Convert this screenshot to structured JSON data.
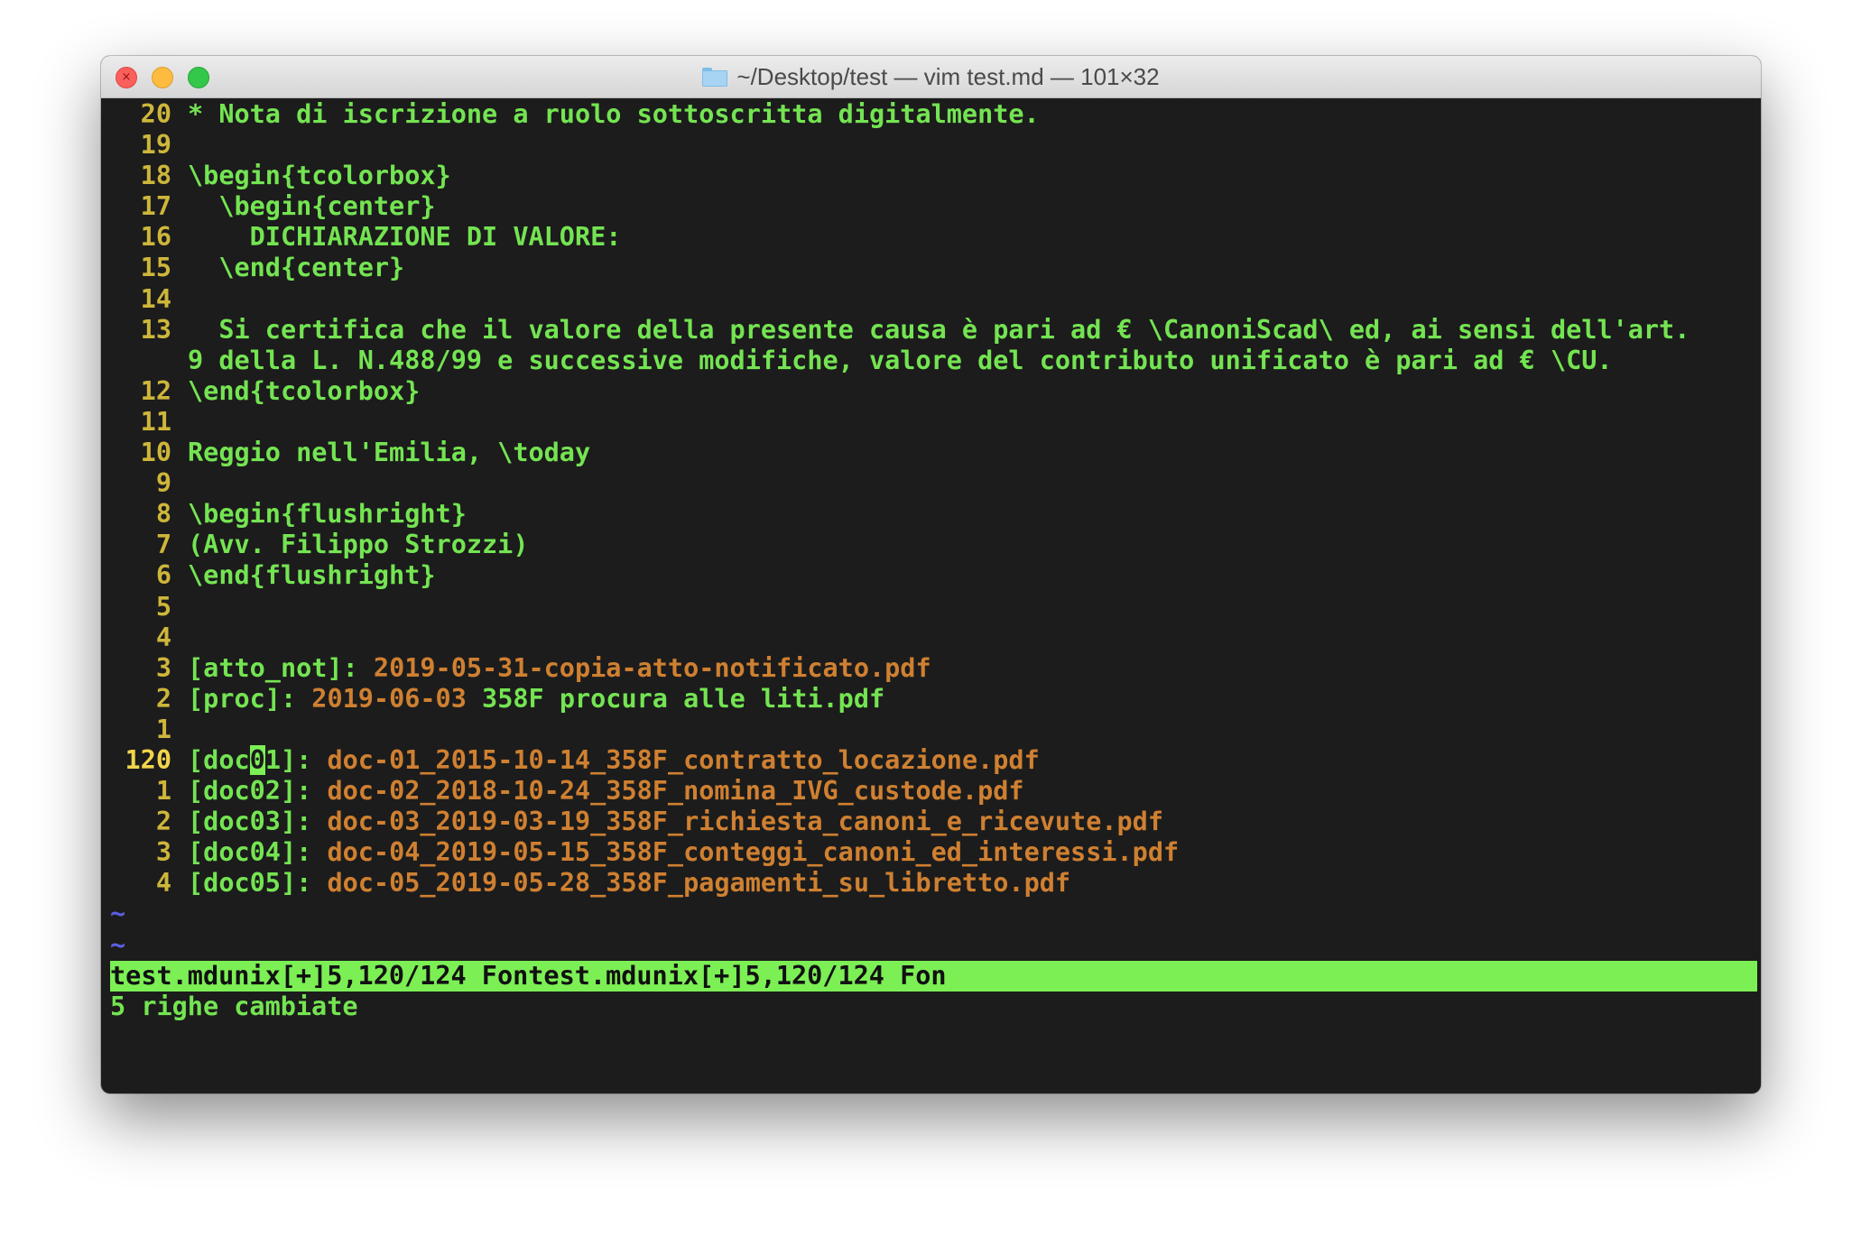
{
  "window": {
    "title": "~/Desktop/test — vim test.md — 101×32",
    "close_glyph": "×"
  },
  "buffer": {
    "lines": [
      {
        "num": "20",
        "parts": [
          {
            "t": "* Nota di iscrizione a ruolo sottoscritta digitalmente.",
            "c": "g"
          }
        ]
      },
      {
        "num": "19",
        "parts": []
      },
      {
        "num": "18",
        "parts": [
          {
            "t": "\\begin{tcolorbox}",
            "c": "g"
          }
        ]
      },
      {
        "num": "17",
        "parts": [
          {
            "t": "  \\begin{center}",
            "c": "g"
          }
        ]
      },
      {
        "num": "16",
        "parts": [
          {
            "t": "    DICHIARAZIONE DI VALORE:",
            "c": "g"
          }
        ]
      },
      {
        "num": "15",
        "parts": [
          {
            "t": "  \\end{center}",
            "c": "g"
          }
        ]
      },
      {
        "num": "14",
        "parts": []
      },
      {
        "num": "13",
        "parts": [
          {
            "t": "  Si certifica che il valore della presente causa è pari ad € \\CanoniScad\\ ed, ai sensi dell'art.",
            "c": "g"
          }
        ]
      },
      {
        "num": "",
        "parts": [
          {
            "t": "9 della L. N.488/99 e successive modifiche, valore del contributo unificato è pari ad € \\CU.",
            "c": "g"
          }
        ]
      },
      {
        "num": "12",
        "parts": [
          {
            "t": "\\end{tcolorbox}",
            "c": "g"
          }
        ]
      },
      {
        "num": "11",
        "parts": []
      },
      {
        "num": "10",
        "parts": [
          {
            "t": "Reggio nell'Emilia, \\today",
            "c": "g"
          }
        ]
      },
      {
        "num": "9",
        "parts": []
      },
      {
        "num": "8",
        "parts": [
          {
            "t": "\\begin{flushright}",
            "c": "g"
          }
        ]
      },
      {
        "num": "7",
        "parts": [
          {
            "t": "(Avv. Filippo Strozzi)",
            "c": "g"
          }
        ]
      },
      {
        "num": "6",
        "parts": [
          {
            "t": "\\end{flushright}",
            "c": "g"
          }
        ]
      },
      {
        "num": "5",
        "parts": []
      },
      {
        "num": "4",
        "parts": []
      },
      {
        "num": "3",
        "parts": [
          {
            "t": "[atto_not]: ",
            "c": "g"
          },
          {
            "t": "2019-05-31-copia-atto-notificato.pdf",
            "c": "o"
          }
        ]
      },
      {
        "num": "2",
        "parts": [
          {
            "t": "[proc]: ",
            "c": "g"
          },
          {
            "t": "2019-06-03 ",
            "c": "o"
          },
          {
            "t": "358F procura alle liti.pdf",
            "c": "g"
          }
        ]
      },
      {
        "num": "1",
        "parts": []
      },
      {
        "num": "120",
        "current": true,
        "parts": [
          {
            "t": "[doc",
            "c": "g"
          },
          {
            "t": "0",
            "c": "cursor"
          },
          {
            "t": "1]: ",
            "c": "g"
          },
          {
            "t": "doc-01_2015-10-14_358F_contratto_locazione.pdf",
            "c": "o"
          }
        ]
      },
      {
        "num": "1",
        "parts": [
          {
            "t": "[doc02]: ",
            "c": "g"
          },
          {
            "t": "doc-02_2018-10-24_358F_nomina_IVG_custode.pdf",
            "c": "o"
          }
        ]
      },
      {
        "num": "2",
        "parts": [
          {
            "t": "[doc03]: ",
            "c": "g"
          },
          {
            "t": "doc-03_2019-03-19_358F_richiesta_canoni_e_ricevute.pdf",
            "c": "o"
          }
        ]
      },
      {
        "num": "3",
        "parts": [
          {
            "t": "[doc04]: ",
            "c": "g"
          },
          {
            "t": "doc-04_2019-05-15_358F_conteggi_canoni_ed_interessi.pdf",
            "c": "o"
          }
        ]
      },
      {
        "num": "4",
        "parts": [
          {
            "t": "[doc05]: ",
            "c": "g"
          },
          {
            "t": "doc-05_2019-05-28_358F_pagamenti_su_libretto.pdf",
            "c": "o"
          }
        ]
      }
    ],
    "filler_lines": [
      "~",
      "~"
    ]
  },
  "statusline": "test.mdunix[+]5,120/124 Fontest.mdunix[+]5,120/124 Fon",
  "message": "5 righe cambiate",
  "colors": {
    "background": "#1c1c1c",
    "text_green": "#74e452",
    "link_orange": "#cf8031",
    "line_number": "#cdb63a",
    "statusline_bg": "#7cef55",
    "tilde": "#5a5fe0"
  }
}
